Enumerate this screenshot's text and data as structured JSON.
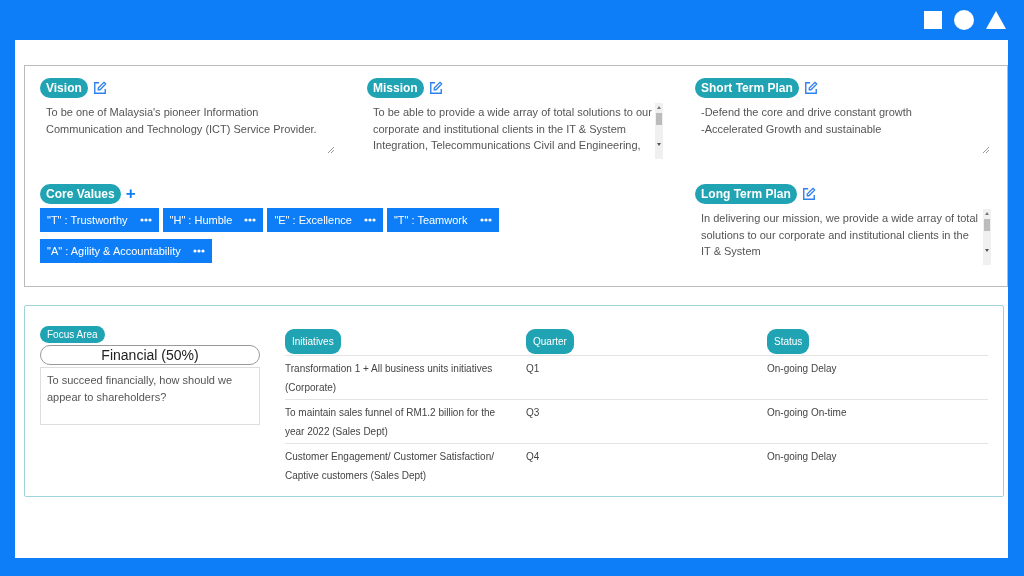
{
  "statements": [
    {
      "label": "Vision",
      "text": "To be one of Malaysia's pioneer Information Communication and Technology (ICT) Service Provider.",
      "scrollable": false
    },
    {
      "label": "Mission",
      "text": "To be able to provide a wide array of total solutions to our corporate and institutional clients in the IT & System Integration, Telecommunications Civil and Engineering,",
      "scrollable": true
    },
    {
      "label": "Short Term Plan",
      "text": "-Defend the core and drive constant growth\n-Accelerated Growth and sustainable",
      "scrollable": false
    }
  ],
  "core_values": {
    "label": "Core Values",
    "add_icon": "+",
    "items": [
      "\"T\" : Trustworthy",
      "\"H\" : Humble",
      "\"E\" : Excellence",
      "\"T\" : Teamwork",
      "\"A\" : Agility & Accountability"
    ]
  },
  "long_term_plan": {
    "label": "Long Term Plan",
    "text": "In delivering our mission, we provide a wide array of total solutions to our corporate and institutional clients in the IT & System",
    "scrollable": true
  },
  "focus_area": {
    "label": "Focus Area",
    "title": "Financial (50%)",
    "question": "To succeed financially, how should we appear to shareholders?"
  },
  "table": {
    "columns": [
      "Initiatives",
      "Quarter",
      "Status"
    ],
    "rows": [
      [
        "Transformation 1 + All business units initiatives (Corporate)",
        "Q1",
        "On-going Delay"
      ],
      [
        "To maintain sales funnel of RM1.2 billion for the year 2022 (Sales Dept)",
        "Q3",
        "On-going On-time"
      ],
      [
        "Customer Engagement/ Customer Satisfaction/ Captive customers (Sales Dept)",
        "Q4",
        "On-going Delay"
      ]
    ]
  }
}
